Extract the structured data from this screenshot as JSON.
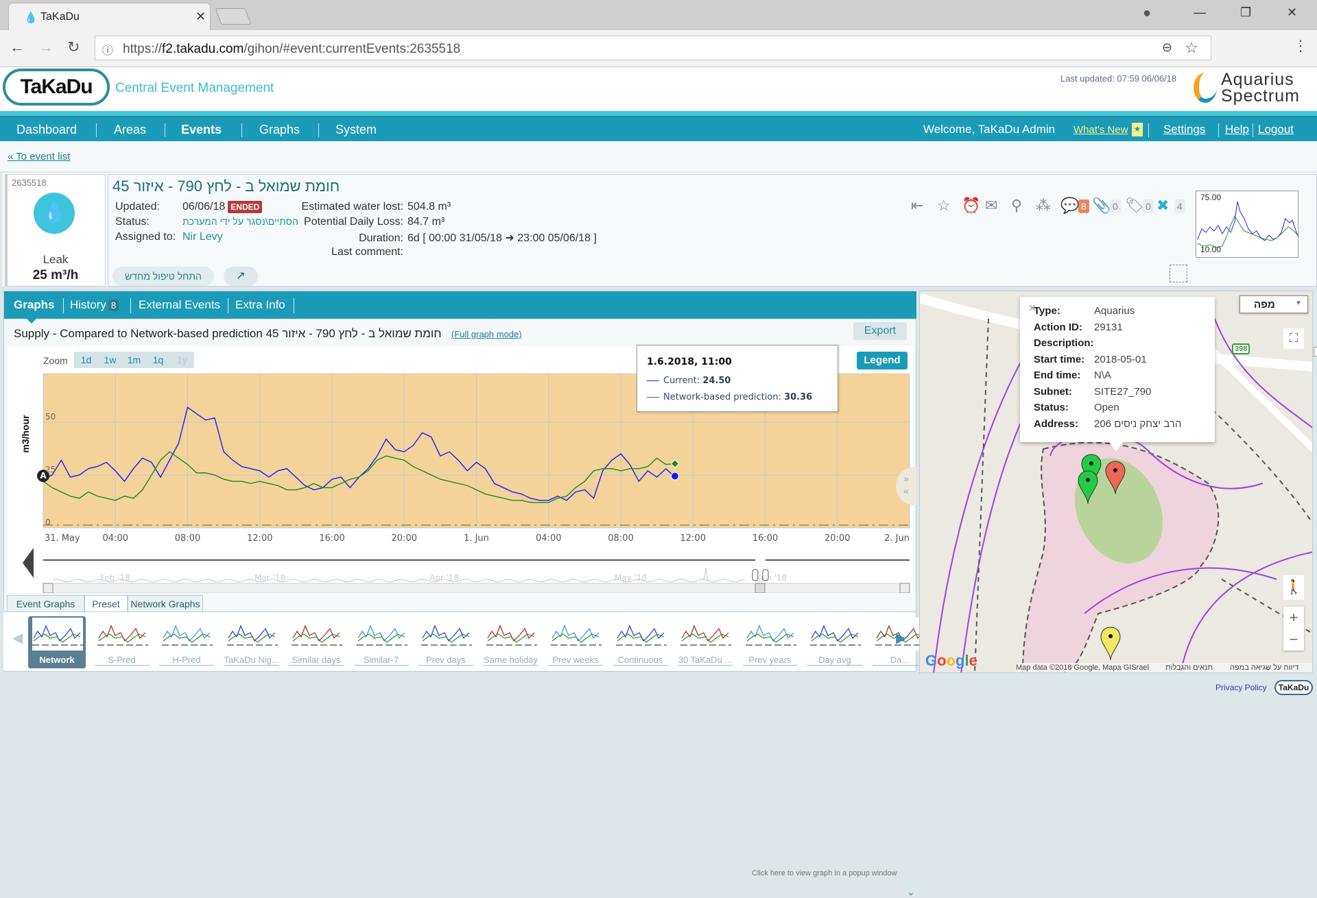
{
  "browser": {
    "tab_title": "TaKaDu",
    "url_scheme": "https://",
    "url_host": "f2.takadu.com",
    "url_path": "/gihon/#event:currentEvents:2635518"
  },
  "header": {
    "logo_text": "TaKaDu",
    "app_title": "Central Event Management",
    "last_updated": "Last updated: 07:59 06/06/18",
    "partner_logo_line1": "Aquarius",
    "partner_logo_line2": "Spectrum"
  },
  "nav": {
    "items": [
      "Dashboard",
      "Areas",
      "Events",
      "Graphs",
      "System"
    ],
    "active": "Events",
    "welcome": "Welcome, TaKaDu Admin",
    "whats_new": "What's New",
    "settings": "Settings",
    "help": "Help",
    "logout": "Logout"
  },
  "back_link": "« To event list",
  "event": {
    "id": "2635518",
    "type_label": "Leak",
    "rate": "25 m³/h",
    "title": "חומת שמואל ב - לחץ 790 - איזור 45",
    "updated_label": "Updated:",
    "updated_value": "06/06/18",
    "state_badge": "ENDED",
    "status_label": "Status:",
    "status_value": "הסתיים\\נסגר על ידי המערכת",
    "assigned_label": "Assigned to:",
    "assigned_value": "Nir Levy",
    "water_lost_label": "Estimated water lost:",
    "water_lost_value": "504.8 m³",
    "daily_loss_label": "Potential Daily Loss:",
    "daily_loss_value": "84.7 m³",
    "duration_label": "Duration:",
    "duration_value": "6d [ 00:00 31/05/18 ➜ 23:00 05/06/18 ]",
    "last_comment_label": "Last comment:",
    "last_comment_value": "",
    "restart_button": "התחל טיפול מחדש",
    "comments_count": "8",
    "attachments_count": "0",
    "tags_count": "0",
    "tools_count": "4",
    "mini_chart_max": "75.00",
    "mini_chart_min": "10.00"
  },
  "graphs_panel": {
    "tabs": [
      {
        "label": "Graphs",
        "count": ""
      },
      {
        "label": "History",
        "count": "8"
      },
      {
        "label": "External Events",
        "count": ""
      },
      {
        "label": "Extra Info",
        "count": ""
      }
    ],
    "title": "חומת שמואל ב - לחץ 790 - איזור 45 Supply - Compared to Network-based prediction",
    "full_graph_link": "(Full graph mode)",
    "export_button": "Export",
    "zoom_label": "Zoom",
    "zoom_options": [
      "1d",
      "1w",
      "1m",
      "1q",
      "1y"
    ],
    "legend_button": "Legend",
    "tooltip": {
      "title": "1.6.2018, 11:00",
      "current_label": "Current:",
      "current_value": "24.50",
      "prediction_label": "Network-based prediction:",
      "prediction_value": "30.36"
    },
    "navigator_labels": [
      "Feb '18",
      "Mar '18",
      "Apr '18",
      "May '18",
      "Jun '18"
    ],
    "popup_hint": "Click here to view graph in a popup window",
    "sub_tabs": [
      "Event Graphs",
      "Preset",
      "Network Graphs"
    ],
    "active_sub_tab": "Preset",
    "thumbnails": [
      "Network",
      "S-Pred",
      "H-Pred",
      "TaKaDu Nig...",
      "Similar days",
      "Similar-7",
      "Prev days",
      "Same holiday",
      "Prev weeks",
      "Continuous",
      "30 TaKaDu ...",
      "Prev years",
      "Day avg",
      "Da..."
    ],
    "active_thumbnail": "Network"
  },
  "chart_data": {
    "type": "line",
    "title": "Supply - Compared to Network-based prediction",
    "xlabel": "",
    "ylabel": "m3/hour",
    "ylim": [
      0,
      73
    ],
    "yticks": [
      0,
      25,
      50
    ],
    "x_range_hours": [
      0,
      48
    ],
    "x_ticks": [
      {
        "h": 0,
        "label": "31. May"
      },
      {
        "h": 4,
        "label": "04:00"
      },
      {
        "h": 8,
        "label": "08:00"
      },
      {
        "h": 12,
        "label": "12:00"
      },
      {
        "h": 16,
        "label": "16:00"
      },
      {
        "h": 20,
        "label": "20:00"
      },
      {
        "h": 24,
        "label": "1. Jun"
      },
      {
        "h": 28,
        "label": "04:00"
      },
      {
        "h": 32,
        "label": "08:00"
      },
      {
        "h": 36,
        "label": "12:00"
      },
      {
        "h": 40,
        "label": "16:00"
      },
      {
        "h": 44,
        "label": "20:00"
      },
      {
        "h": 48,
        "label": "2. Jun"
      }
    ],
    "grid": true,
    "marker_label": "A",
    "series": [
      {
        "name": "Current",
        "color": "#1a1aff",
        "x_hours": [
          0,
          0.5,
          1,
          1.5,
          2,
          2.5,
          3,
          3.5,
          4,
          4.5,
          5,
          5.5,
          6,
          6.5,
          7,
          7.5,
          8,
          8.5,
          9,
          9.5,
          10,
          10.5,
          11,
          11.5,
          12,
          12.5,
          13,
          13.5,
          14,
          14.5,
          15,
          15.5,
          16,
          16.5,
          17,
          17.5,
          18,
          18.5,
          19,
          19.5,
          20,
          20.5,
          21,
          21.5,
          22,
          22.5,
          23,
          23.5,
          24,
          24.5,
          25,
          25.5,
          26,
          26.5,
          27,
          27.5,
          28,
          28.5,
          29,
          29.5,
          30,
          30.5,
          31,
          31.5,
          32,
          32.5,
          33,
          33.5,
          34,
          34.5,
          35
        ],
        "values": [
          23,
          25,
          32,
          24,
          25,
          28,
          29,
          31,
          27,
          22,
          28,
          33,
          31,
          24,
          32,
          40,
          57,
          54,
          51,
          52,
          36,
          32,
          29,
          28,
          27,
          24,
          27,
          28,
          24,
          20,
          18,
          19,
          23,
          24,
          19,
          24,
          28,
          34,
          42,
          37,
          36,
          39,
          45,
          43,
          34,
          36,
          32,
          27,
          31,
          28,
          21,
          19,
          17,
          16,
          14,
          13,
          13,
          15,
          13,
          17,
          18,
          14,
          27,
          32,
          35,
          30,
          22,
          27,
          24,
          28,
          24
        ],
        "current_point": {
          "h": 35,
          "value": 24.5
        }
      },
      {
        "name": "Network-based prediction",
        "color": "#1a8a1a",
        "x_hours": [
          0,
          0.5,
          1,
          1.5,
          2,
          2.5,
          3,
          3.5,
          4,
          4.5,
          5,
          5.5,
          6,
          6.5,
          7,
          7.5,
          8,
          8.5,
          9,
          9.5,
          10,
          10.5,
          11,
          11.5,
          12,
          12.5,
          13,
          13.5,
          14,
          14.5,
          15,
          15.5,
          16,
          16.5,
          17,
          17.5,
          18,
          18.5,
          19,
          19.5,
          20,
          20.5,
          21,
          21.5,
          22,
          22.5,
          23,
          23.5,
          24,
          24.5,
          25,
          25.5,
          26,
          26.5,
          27,
          27.5,
          28,
          28.5,
          29,
          29.5,
          30,
          30.5,
          31,
          31.5,
          32,
          32.5,
          33,
          33.5,
          34,
          34.5,
          35
        ],
        "values": [
          22,
          19,
          17,
          15,
          14,
          17,
          15,
          14,
          13,
          15,
          14,
          18,
          25,
          32,
          36,
          33,
          30,
          26,
          26,
          25,
          23,
          22,
          22,
          21,
          22,
          21,
          20,
          18,
          18,
          19,
          21,
          19,
          19,
          21,
          23,
          24,
          27,
          32,
          34,
          33,
          32,
          29,
          27,
          25,
          23,
          22,
          21,
          20,
          18,
          16,
          15,
          14,
          13,
          13,
          12,
          12,
          12,
          14,
          15,
          19,
          22,
          27,
          28,
          28,
          27,
          28,
          28,
          29,
          33,
          30,
          30.36
        ],
        "current_point": {
          "h": 35,
          "value": 30.36
        }
      }
    ]
  },
  "map": {
    "type_select": "מפה",
    "info": [
      {
        "k": "Type",
        "v": "Aquarius"
      },
      {
        "k": "Action ID",
        "v": "29131"
      },
      {
        "k": "Description",
        "v": ""
      },
      {
        "k": "Start time",
        "v": "2018-05-01"
      },
      {
        "k": "End time",
        "v": "N\\A"
      },
      {
        "k": "Subnet",
        "v": "SITE27_790"
      },
      {
        "k": "Status",
        "v": "Open"
      },
      {
        "k": "Address",
        "v": "הרב יצחק ניסים 206"
      }
    ],
    "road_number": "398",
    "attribution": "Map data ©2018 Google, Mapa GISrael",
    "terms": "תנאים והגבלות",
    "report": "דיווח על שגיאה במפה",
    "google": "Google"
  },
  "footer": {
    "privacy": "Privacy Policy",
    "logo": "TaKaDu"
  }
}
